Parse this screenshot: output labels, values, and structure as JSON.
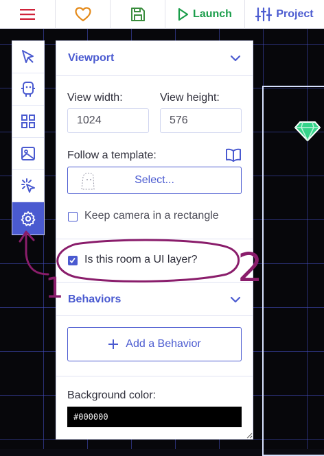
{
  "topbar": {
    "menu_icon": "hamburger-menu-icon",
    "favorite_icon": "heart-icon",
    "save_icon": "floppy-disk-icon",
    "launch_label": "Launch",
    "project_label": "Project"
  },
  "tools": [
    {
      "icon": "cursor-select-icon",
      "active": false
    },
    {
      "icon": "robot-copy-icon",
      "active": false
    },
    {
      "icon": "grid-tiles-icon",
      "active": false
    },
    {
      "icon": "image-backgrounds-icon",
      "active": false
    },
    {
      "icon": "sparkle-cursor-icon",
      "active": false
    },
    {
      "icon": "gear-settings-icon",
      "active": true
    }
  ],
  "panel": {
    "viewport_title": "Viewport",
    "view_width_label": "View width:",
    "view_height_label": "View height:",
    "view_width_value": "1024",
    "view_height_value": "576",
    "template_label": "Follow a template:",
    "select_label": "Select...",
    "keep_camera_label": "Keep camera in a rectangle",
    "keep_camera_checked": false,
    "ui_layer_label": "Is this room a UI layer?",
    "ui_layer_checked": true,
    "behaviors_title": "Behaviors",
    "add_behavior_label": "Add a Behavior",
    "bg_color_label": "Background color:",
    "bg_color_value": "#000000"
  },
  "annotations": {
    "arrow_number": "1",
    "circle_number": "2",
    "ink_color": "#8a1d6b"
  },
  "colors": {
    "accent": "#4a5ad0",
    "menu_red": "#d0233a",
    "heart_orange": "#e48a1a",
    "save_green": "#3a8d3d",
    "launch_green": "#1a9d4a",
    "gem": "#35d38a"
  }
}
